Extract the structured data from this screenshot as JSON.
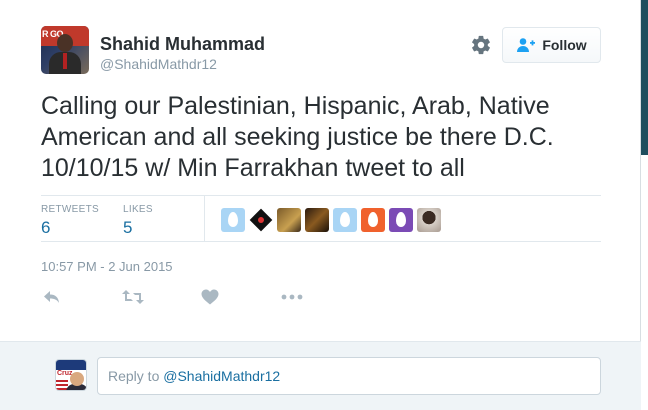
{
  "user": {
    "display_name": "Shahid Muhammad",
    "screen_name": "@ShahidMathdr12",
    "avatar_poster_text": "R GO"
  },
  "header": {
    "follow_label": "Follow",
    "settings_icon": "gear-icon",
    "follow_icon": "person-plus-icon"
  },
  "tweet": {
    "text": "Calling our Palestinian, Hispanic, Arab, Native American and all seeking justice be there D.C. 10/10/15 w/ Min Farrakhan tweet to all",
    "timestamp": "10:57 PM - 2 Jun 2015"
  },
  "stats": {
    "retweets_label": "RETWEETS",
    "retweets_value": "6",
    "likes_label": "LIKES",
    "likes_value": "5"
  },
  "likers": [
    {
      "kind": "egg",
      "color": "#a9d5f5"
    },
    {
      "kind": "diamond",
      "color": "#111111"
    },
    {
      "kind": "photo",
      "color": "#c8a050"
    },
    {
      "kind": "photo",
      "color": "#8a5a20"
    },
    {
      "kind": "egg",
      "color": "#a9d5f5"
    },
    {
      "kind": "egg",
      "color": "#f0612d"
    },
    {
      "kind": "egg",
      "color": "#7b4bb5"
    },
    {
      "kind": "photo",
      "color": "#3a2a22"
    }
  ],
  "actions": [
    "reply-icon",
    "retweet-icon",
    "heart-icon",
    "more-icon"
  ],
  "reply": {
    "prefix": "Reply to ",
    "handle": "@ShahidMathdr12",
    "avatar_text": "Cruz"
  },
  "colors": {
    "link": "#1a6fa1",
    "muted": "#8899a6",
    "text": "#292f33",
    "icon": "#aab8c2"
  }
}
